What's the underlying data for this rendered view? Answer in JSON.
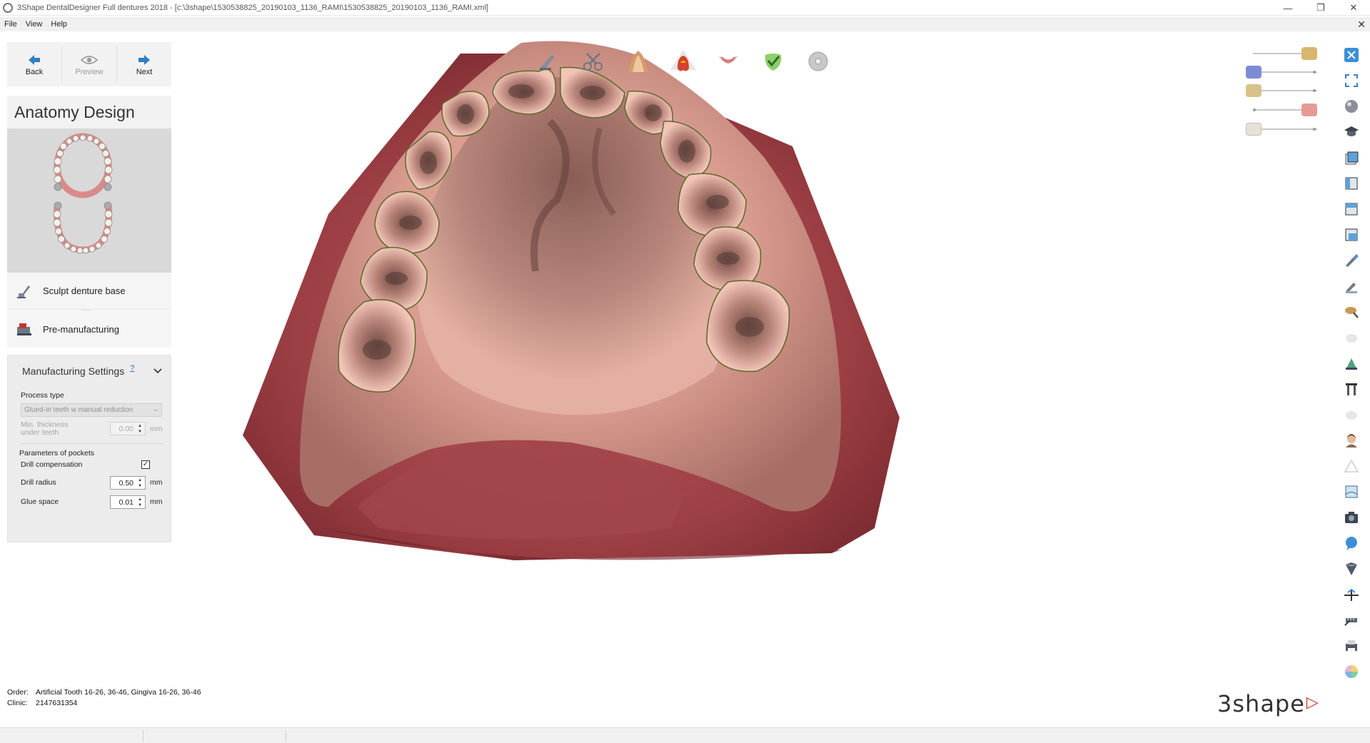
{
  "window": {
    "title": "3Shape DentalDesigner Full dentures 2018 - [c:\\3shape\\1530538825_20190103_1136_RAMI\\1530538825_20190103_1136_RAMI.xml]",
    "controls": [
      "—",
      "❐",
      "✕"
    ]
  },
  "menu": {
    "items": [
      "File",
      "View",
      "Help"
    ],
    "close": "✕"
  },
  "nav": {
    "back": "Back",
    "preview": "Preview",
    "next": "Next"
  },
  "anatomy": {
    "title": "Anatomy Design"
  },
  "steps": {
    "sculpt": "Sculpt denture base",
    "premanufacturing": "Pre-manufacturing"
  },
  "manufacturing": {
    "title": "Manufacturing Settings",
    "help": "?",
    "process_type_label": "Process type",
    "process_type_value": "Glued-in teeth w manual reduction",
    "min_thickness_label_1": "Min. thickness",
    "min_thickness_label_2": "under teeth",
    "min_thickness_value": "0.00",
    "min_thickness_unit": "mm",
    "pockets_label": "Parameters of pockets",
    "drill_comp_label": "Drill compensation",
    "drill_comp_checked": true,
    "drill_radius_label": "Drill radius",
    "drill_radius_value": "0.50",
    "drill_radius_unit": "mm",
    "glue_space_label": "Glue space",
    "glue_space_value": "0.01",
    "glue_space_unit": "mm"
  },
  "order": {
    "order_label": "Order:",
    "order_value": "Artificial Tooth 16-26, 36-46, Gingiva 16-26, 36-46",
    "clinic_label": "Clinic:",
    "clinic_value": "2147631354"
  },
  "logo": {
    "text": "3shape"
  },
  "toptools": [
    "sculpt-knife-icon",
    "scissors-icon",
    "tooth-setup-icon",
    "active-tooth-icon",
    "gingiva-icon",
    "checkmark-tooth-icon",
    "disc-icon"
  ],
  "sliders": [
    {
      "icon": "tooth-model-icon",
      "level": 0.95
    },
    {
      "icon": "jaw-scan-icon",
      "level": 0.05
    },
    {
      "icon": "tooth-model-icon",
      "level": 0.05
    },
    {
      "icon": "gingiva-icon",
      "level": 0.95
    },
    {
      "icon": "tooth-white-icon",
      "level": 0.05
    }
  ],
  "righttools": [
    "close-view-icon",
    "fit-view-icon",
    "render-mode-icon",
    "graduation-cap-icon",
    "view-front-icon",
    "view-side-icon",
    "view-top-icon",
    "view-bottom-icon",
    "tool-brush-icon",
    "tool-brush2-icon",
    "tool-smooth-icon",
    "tool-disabled-icon",
    "tool-wax-icon",
    "tool-measure-icon",
    "tool-disabled2-icon",
    "avatar-icon",
    "warning-icon",
    "tool-box-icon",
    "camera-icon",
    "chat-icon",
    "shield-icon",
    "section-icon",
    "ruler-icon",
    "print-icon",
    "color-wheel-icon"
  ]
}
